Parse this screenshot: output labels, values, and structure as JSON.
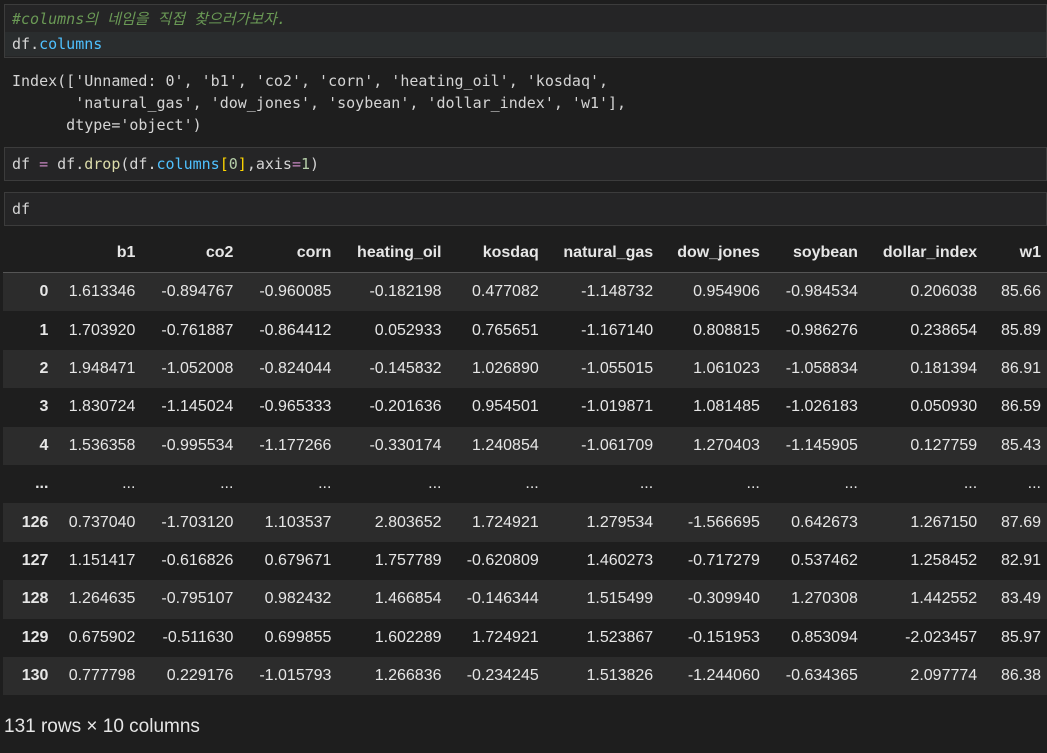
{
  "cell1": {
    "comment": "#columns의 네임을 직접 찾으러가보자.",
    "var": "df",
    "dot": ".",
    "attr": "columns"
  },
  "output1": {
    "line1": "Index(['Unnamed: 0', 'b1', 'co2', 'corn', 'heating_oil', 'kosdaq',",
    "line2": "       'natural_gas', 'dow_jones', 'soybean', 'dollar_index', 'w1'],",
    "line3": "      dtype='object')"
  },
  "cell2": {
    "lhs": "df",
    "eq": " = ",
    "obj": "df",
    "dot1": ".",
    "func": "drop",
    "open": "(",
    "obj2": "df",
    "dot2": ".",
    "attr": "columns",
    "bracket_open": "[",
    "index": "0",
    "bracket_close": "]",
    "comma": ",",
    "kwarg": "axis",
    "eq2": "=",
    "value": "1",
    "close": ")"
  },
  "cell3": {
    "var": "df"
  },
  "table": {
    "columns": [
      "",
      "b1",
      "co2",
      "corn",
      "heating_oil",
      "kosdaq",
      "natural_gas",
      "dow_jones",
      "soybean",
      "dollar_index",
      "w1"
    ],
    "rows": [
      [
        "0",
        "1.613346",
        "-0.894767",
        "-0.960085",
        "-0.182198",
        "0.477082",
        "-1.148732",
        "0.954906",
        "-0.984534",
        "0.206038",
        "85.66"
      ],
      [
        "1",
        "1.703920",
        "-0.761887",
        "-0.864412",
        "0.052933",
        "0.765651",
        "-1.167140",
        "0.808815",
        "-0.986276",
        "0.238654",
        "85.89"
      ],
      [
        "2",
        "1.948471",
        "-1.052008",
        "-0.824044",
        "-0.145832",
        "1.026890",
        "-1.055015",
        "1.061023",
        "-1.058834",
        "0.181394",
        "86.91"
      ],
      [
        "3",
        "1.830724",
        "-1.145024",
        "-0.965333",
        "-0.201636",
        "0.954501",
        "-1.019871",
        "1.081485",
        "-1.026183",
        "0.050930",
        "86.59"
      ],
      [
        "4",
        "1.536358",
        "-0.995534",
        "-1.177266",
        "-0.330174",
        "1.240854",
        "-1.061709",
        "1.270403",
        "-1.145905",
        "0.127759",
        "85.43"
      ],
      [
        "...",
        "...",
        "...",
        "...",
        "...",
        "...",
        "...",
        "...",
        "...",
        "...",
        "..."
      ],
      [
        "126",
        "0.737040",
        "-1.703120",
        "1.103537",
        "2.803652",
        "1.724921",
        "1.279534",
        "-1.566695",
        "0.642673",
        "1.267150",
        "87.69"
      ],
      [
        "127",
        "1.151417",
        "-0.616826",
        "0.679671",
        "1.757789",
        "-0.620809",
        "1.460273",
        "-0.717279",
        "0.537462",
        "1.258452",
        "82.91"
      ],
      [
        "128",
        "1.264635",
        "-0.795107",
        "0.982432",
        "1.466854",
        "-0.146344",
        "1.515499",
        "-0.309940",
        "1.270308",
        "1.442552",
        "83.49"
      ],
      [
        "129",
        "0.675902",
        "-0.511630",
        "0.699855",
        "1.602289",
        "1.724921",
        "1.523867",
        "-0.151953",
        "0.853094",
        "-2.023457",
        "85.97"
      ],
      [
        "130",
        "0.777798",
        "0.229176",
        "-1.015793",
        "1.266836",
        "-0.234245",
        "1.513826",
        "-1.244060",
        "-0.634365",
        "2.097774",
        "86.38"
      ]
    ]
  },
  "summary": "131 rows × 10 columns"
}
